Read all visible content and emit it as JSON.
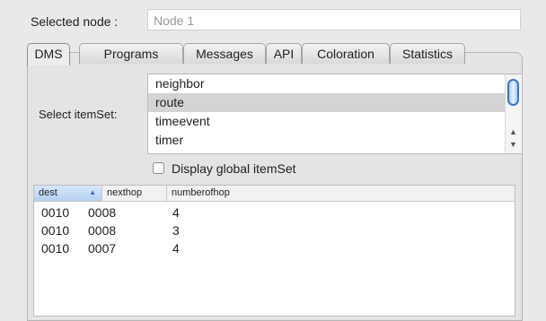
{
  "selected_node": {
    "label": "Selected node :",
    "value": "Node 1"
  },
  "tabs": [
    {
      "label": "DMS",
      "active": true
    },
    {
      "label": "Programs",
      "active": false
    },
    {
      "label": "Messages",
      "active": false
    },
    {
      "label": "API",
      "active": false
    },
    {
      "label": "Coloration",
      "active": false
    },
    {
      "label": "Statistics",
      "active": false
    }
  ],
  "itemset": {
    "label": "Select itemSet:",
    "items": [
      "neighbor",
      "route",
      "timeevent",
      "timer"
    ],
    "selected": "route",
    "display_global_label": "Display global itemSet",
    "display_global_checked": false
  },
  "table": {
    "columns": [
      "dest",
      "nexthop",
      "numberofhop"
    ],
    "sorted_column": "dest",
    "sort_direction": "ascending",
    "rows": [
      [
        "0010",
        "0008",
        "4"
      ],
      [
        "0010",
        "0008",
        "3"
      ],
      [
        "0010",
        "0007",
        "4"
      ]
    ]
  },
  "icons": {
    "sort": "sort-ascending-icon",
    "scroll_up": "chevron-up-icon",
    "scroll_down": "chevron-down-icon"
  },
  "colors": {
    "selection": "#d4d4d4",
    "accent": "#3b77c2"
  }
}
